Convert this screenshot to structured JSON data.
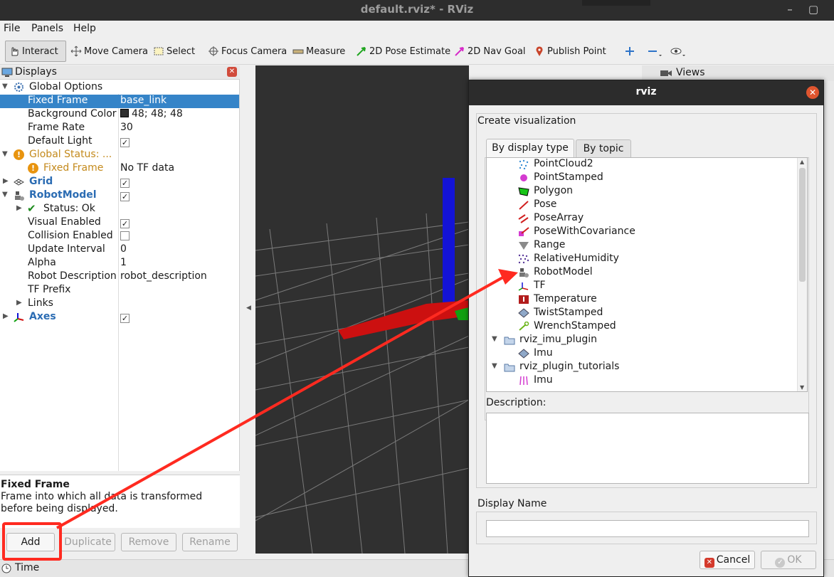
{
  "window": {
    "title": "default.rviz* - RViz",
    "minimize_icon": "minimize-icon",
    "maximize_icon": "maximize-icon",
    "close_icon": "close-icon"
  },
  "menu": [
    "File",
    "Panels",
    "Help"
  ],
  "toolbar": {
    "tools": [
      "Interact",
      "Move Camera",
      "Select",
      "Focus Camera",
      "Measure",
      "2D Pose Estimate",
      "2D Nav Goal",
      "Publish Point"
    ],
    "active": "Interact",
    "extra_icons": [
      "plus-icon",
      "minus-icon",
      "eye-icon"
    ]
  },
  "displays": {
    "title": "Displays",
    "rows": {
      "global_options": "Global Options",
      "fixed_frame_key": "Fixed Frame",
      "fixed_frame_val": "base_link",
      "bg_key": "Background Color",
      "bg_val": "48; 48; 48",
      "framerate_key": "Frame Rate",
      "framerate_val": "30",
      "default_light_key": "Default Light",
      "global_status": "Global Status: ...",
      "status_fixed_key": "Fixed Frame",
      "status_fixed_val": "No TF data",
      "grid": "Grid",
      "robotmodel": "RobotModel",
      "status_ok": "Status: Ok",
      "visual_key": "Visual Enabled",
      "collision_key": "Collision Enabled",
      "update_key": "Update Interval",
      "update_val": "0",
      "alpha_key": "Alpha",
      "alpha_val": "1",
      "robotdesc_key": "Robot Description",
      "robotdesc_val": "robot_description",
      "tfprefix_key": "TF Prefix",
      "links_key": "Links",
      "axes": "Axes"
    },
    "background_color": "#303030",
    "help_title": "Fixed Frame",
    "help_text": "Frame into which all data is transformed before being displayed.",
    "buttons": {
      "add": "Add",
      "duplicate": "Duplicate",
      "remove": "Remove",
      "rename": "Rename"
    }
  },
  "time_panel": {
    "title": "Time"
  },
  "views_panel": {
    "title": "Views"
  },
  "dialog": {
    "title": "rviz",
    "create_label": "Create visualization",
    "tabs": [
      "By display type",
      "By topic"
    ],
    "list": [
      "PointCloud2",
      "PointStamped",
      "Polygon",
      "Pose",
      "PoseArray",
      "PoseWithCovariance",
      "Range",
      "RelativeHumidity",
      "RobotModel",
      "TF",
      "Temperature",
      "TwistStamped",
      "WrenchStamped",
      "rviz_imu_plugin",
      "Imu",
      "rviz_plugin_tutorials",
      "Imu"
    ],
    "description_label": "Description:",
    "display_name_label": "Display Name",
    "display_name_value": "",
    "cancel": "Cancel",
    "ok": "OK"
  },
  "colors": {
    "selection": "#3584c8",
    "annotation": "#ff2a20",
    "x_axis": "#d11010",
    "y_axis": "#0ea00e",
    "z_axis": "#1010d8"
  }
}
